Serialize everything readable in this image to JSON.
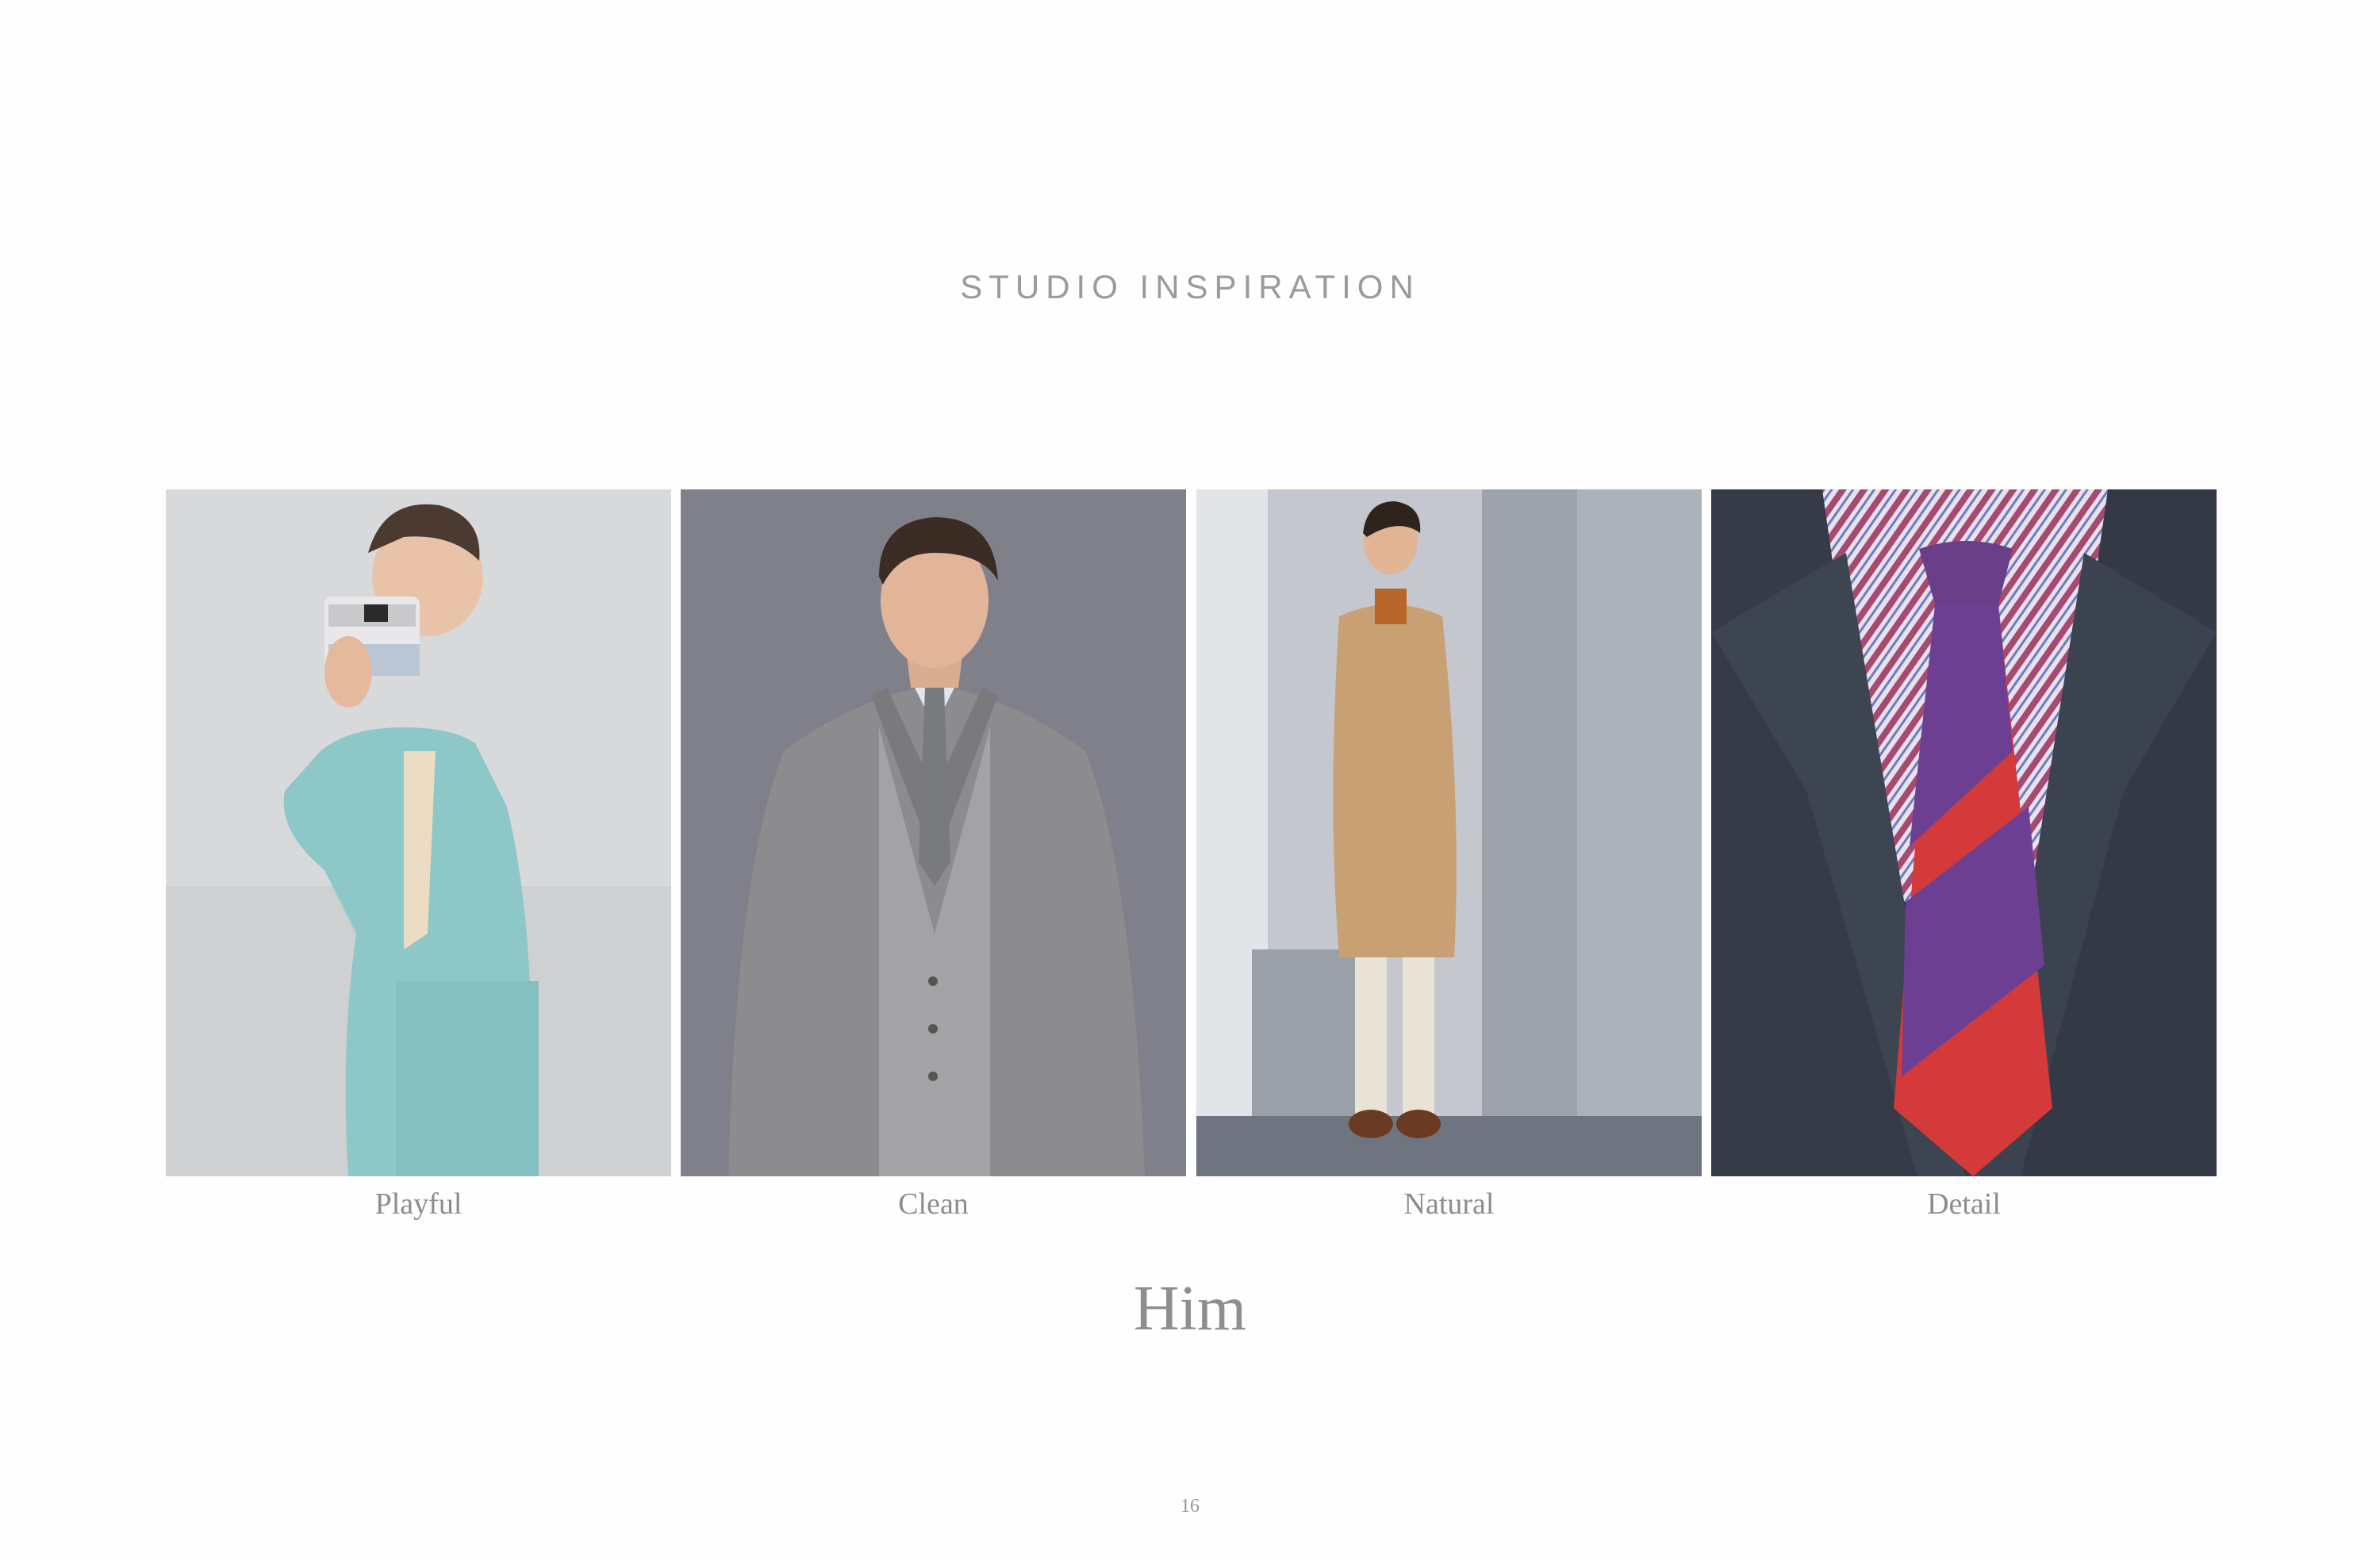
{
  "header": {
    "title": "STUDIO INSPIRATION"
  },
  "gallery": [
    {
      "caption": "Playful"
    },
    {
      "caption": "Clean"
    },
    {
      "caption": "Natural"
    },
    {
      "caption": "Detail"
    }
  ],
  "section": {
    "heading": "Him"
  },
  "footer": {
    "page_number": "16"
  }
}
